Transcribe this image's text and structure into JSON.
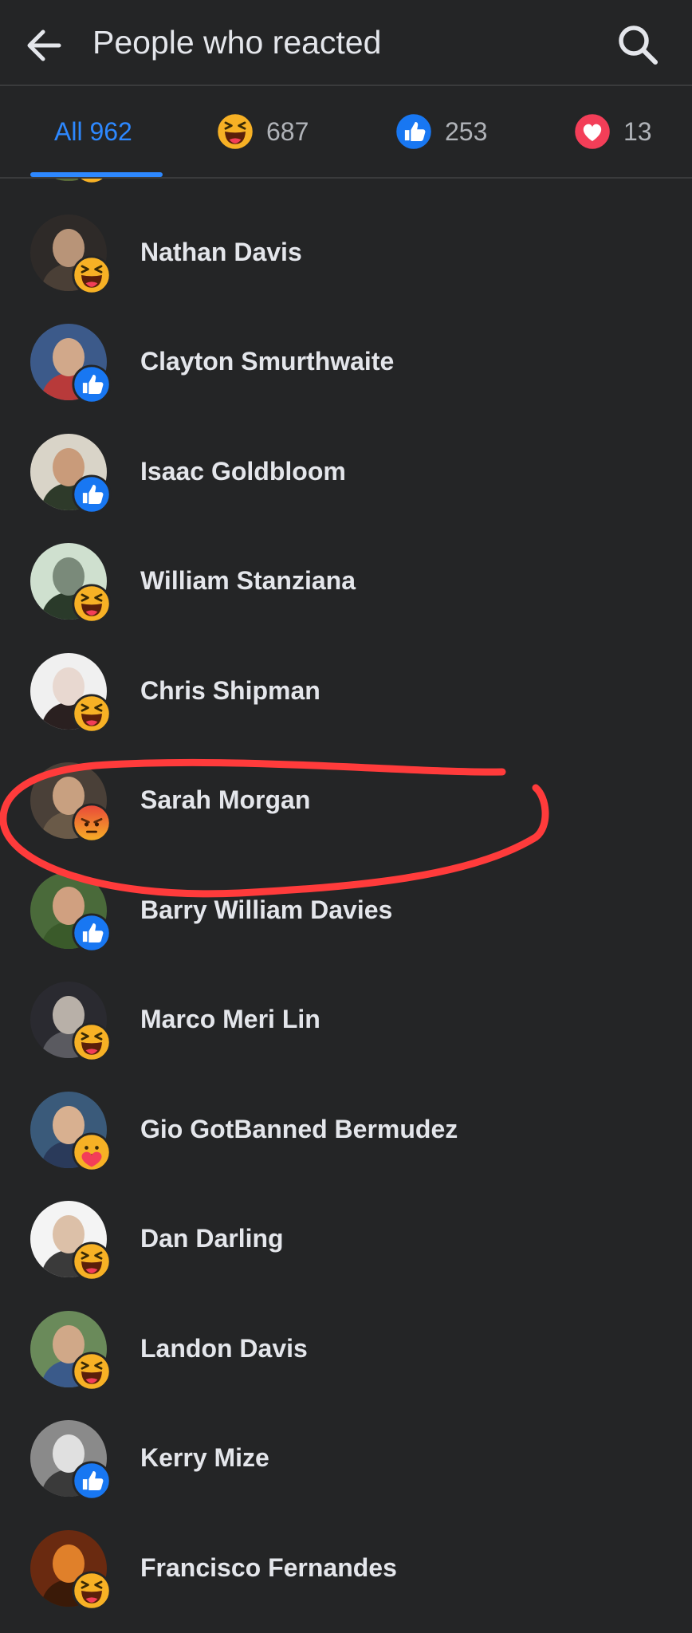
{
  "header": {
    "title": "People who reacted"
  },
  "tabs": [
    {
      "id": "all",
      "label": "All 962"
    },
    {
      "id": "haha",
      "reaction": "haha",
      "count": "687"
    },
    {
      "id": "like",
      "reaction": "like",
      "count": "253"
    },
    {
      "id": "love",
      "reaction": "love",
      "count": "13"
    }
  ],
  "colors": {
    "background": "#242526",
    "accent": "#2d88ff",
    "like": "#1877f2",
    "love": "#f33e58",
    "haha": "#f7b125",
    "angry": "#e9710f",
    "highlight_stroke": "#ff3b3b"
  },
  "people": [
    {
      "name": "",
      "reaction": "haha"
    },
    {
      "name": "Nathan Davis",
      "reaction": "haha"
    },
    {
      "name": "Clayton Smurthwaite",
      "reaction": "like"
    },
    {
      "name": "Isaac Goldbloom",
      "reaction": "like"
    },
    {
      "name": "William Stanziana",
      "reaction": "haha"
    },
    {
      "name": "Chris Shipman",
      "reaction": "haha"
    },
    {
      "name": "Sarah Morgan",
      "reaction": "angry"
    },
    {
      "name": "Barry William Davies",
      "reaction": "like"
    },
    {
      "name": "Marco Meri Lin",
      "reaction": "haha"
    },
    {
      "name": "Gio GotBanned Bermudez",
      "reaction": "care"
    },
    {
      "name": "Dan Darling",
      "reaction": "haha"
    },
    {
      "name": "Landon Davis",
      "reaction": "haha"
    },
    {
      "name": "Kerry Mize",
      "reaction": "like"
    },
    {
      "name": "Francisco Fernandes",
      "reaction": "haha"
    }
  ]
}
